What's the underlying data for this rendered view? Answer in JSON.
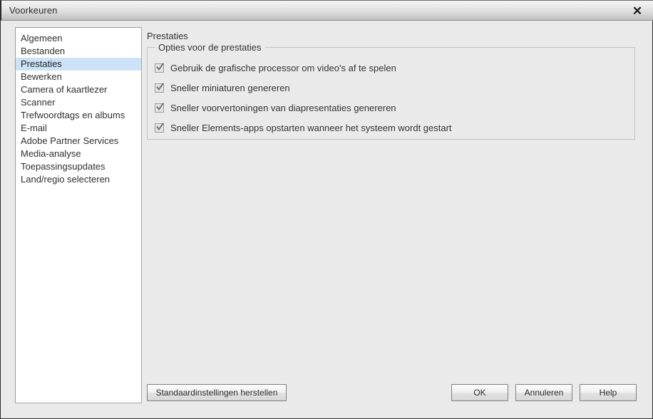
{
  "window": {
    "title": "Voorkeuren",
    "close_icon": "close-icon",
    "close_glyph": "✕"
  },
  "colors": {
    "dialog_background": "#eaeaea",
    "list_background": "#ffffff",
    "selection": "#cce3f7",
    "text": "#333333",
    "border": "#c2c2c2",
    "frame": "#2b2b2b"
  },
  "sidebar": {
    "items": [
      {
        "label": "Algemeen",
        "selected": false
      },
      {
        "label": "Bestanden",
        "selected": false
      },
      {
        "label": "Prestaties",
        "selected": true
      },
      {
        "label": "Bewerken",
        "selected": false
      },
      {
        "label": "Camera of kaartlezer",
        "selected": false
      },
      {
        "label": "Scanner",
        "selected": false
      },
      {
        "label": "Trefwoordtags en albums",
        "selected": false
      },
      {
        "label": "E-mail",
        "selected": false
      },
      {
        "label": "Adobe Partner Services",
        "selected": false
      },
      {
        "label": "Media-analyse",
        "selected": false
      },
      {
        "label": "Toepassingsupdates",
        "selected": false
      },
      {
        "label": "Land/regio selecteren",
        "selected": false
      }
    ]
  },
  "main": {
    "title": "Prestaties",
    "group": {
      "legend": "Opties voor de prestaties",
      "options": [
        {
          "label": "Gebruik de grafische processor om video's af te spelen",
          "checked": true
        },
        {
          "label": "Sneller miniaturen genereren",
          "checked": true
        },
        {
          "label": "Sneller voorvertoningen van diapresentaties genereren",
          "checked": true
        },
        {
          "label": "Sneller Elements-apps opstarten wanneer het systeem wordt gestart",
          "checked": true
        }
      ]
    }
  },
  "footer": {
    "restore_label": "Standaardinstellingen herstellen",
    "ok_label": "OK",
    "cancel_label": "Annuleren",
    "help_label": "Help"
  }
}
